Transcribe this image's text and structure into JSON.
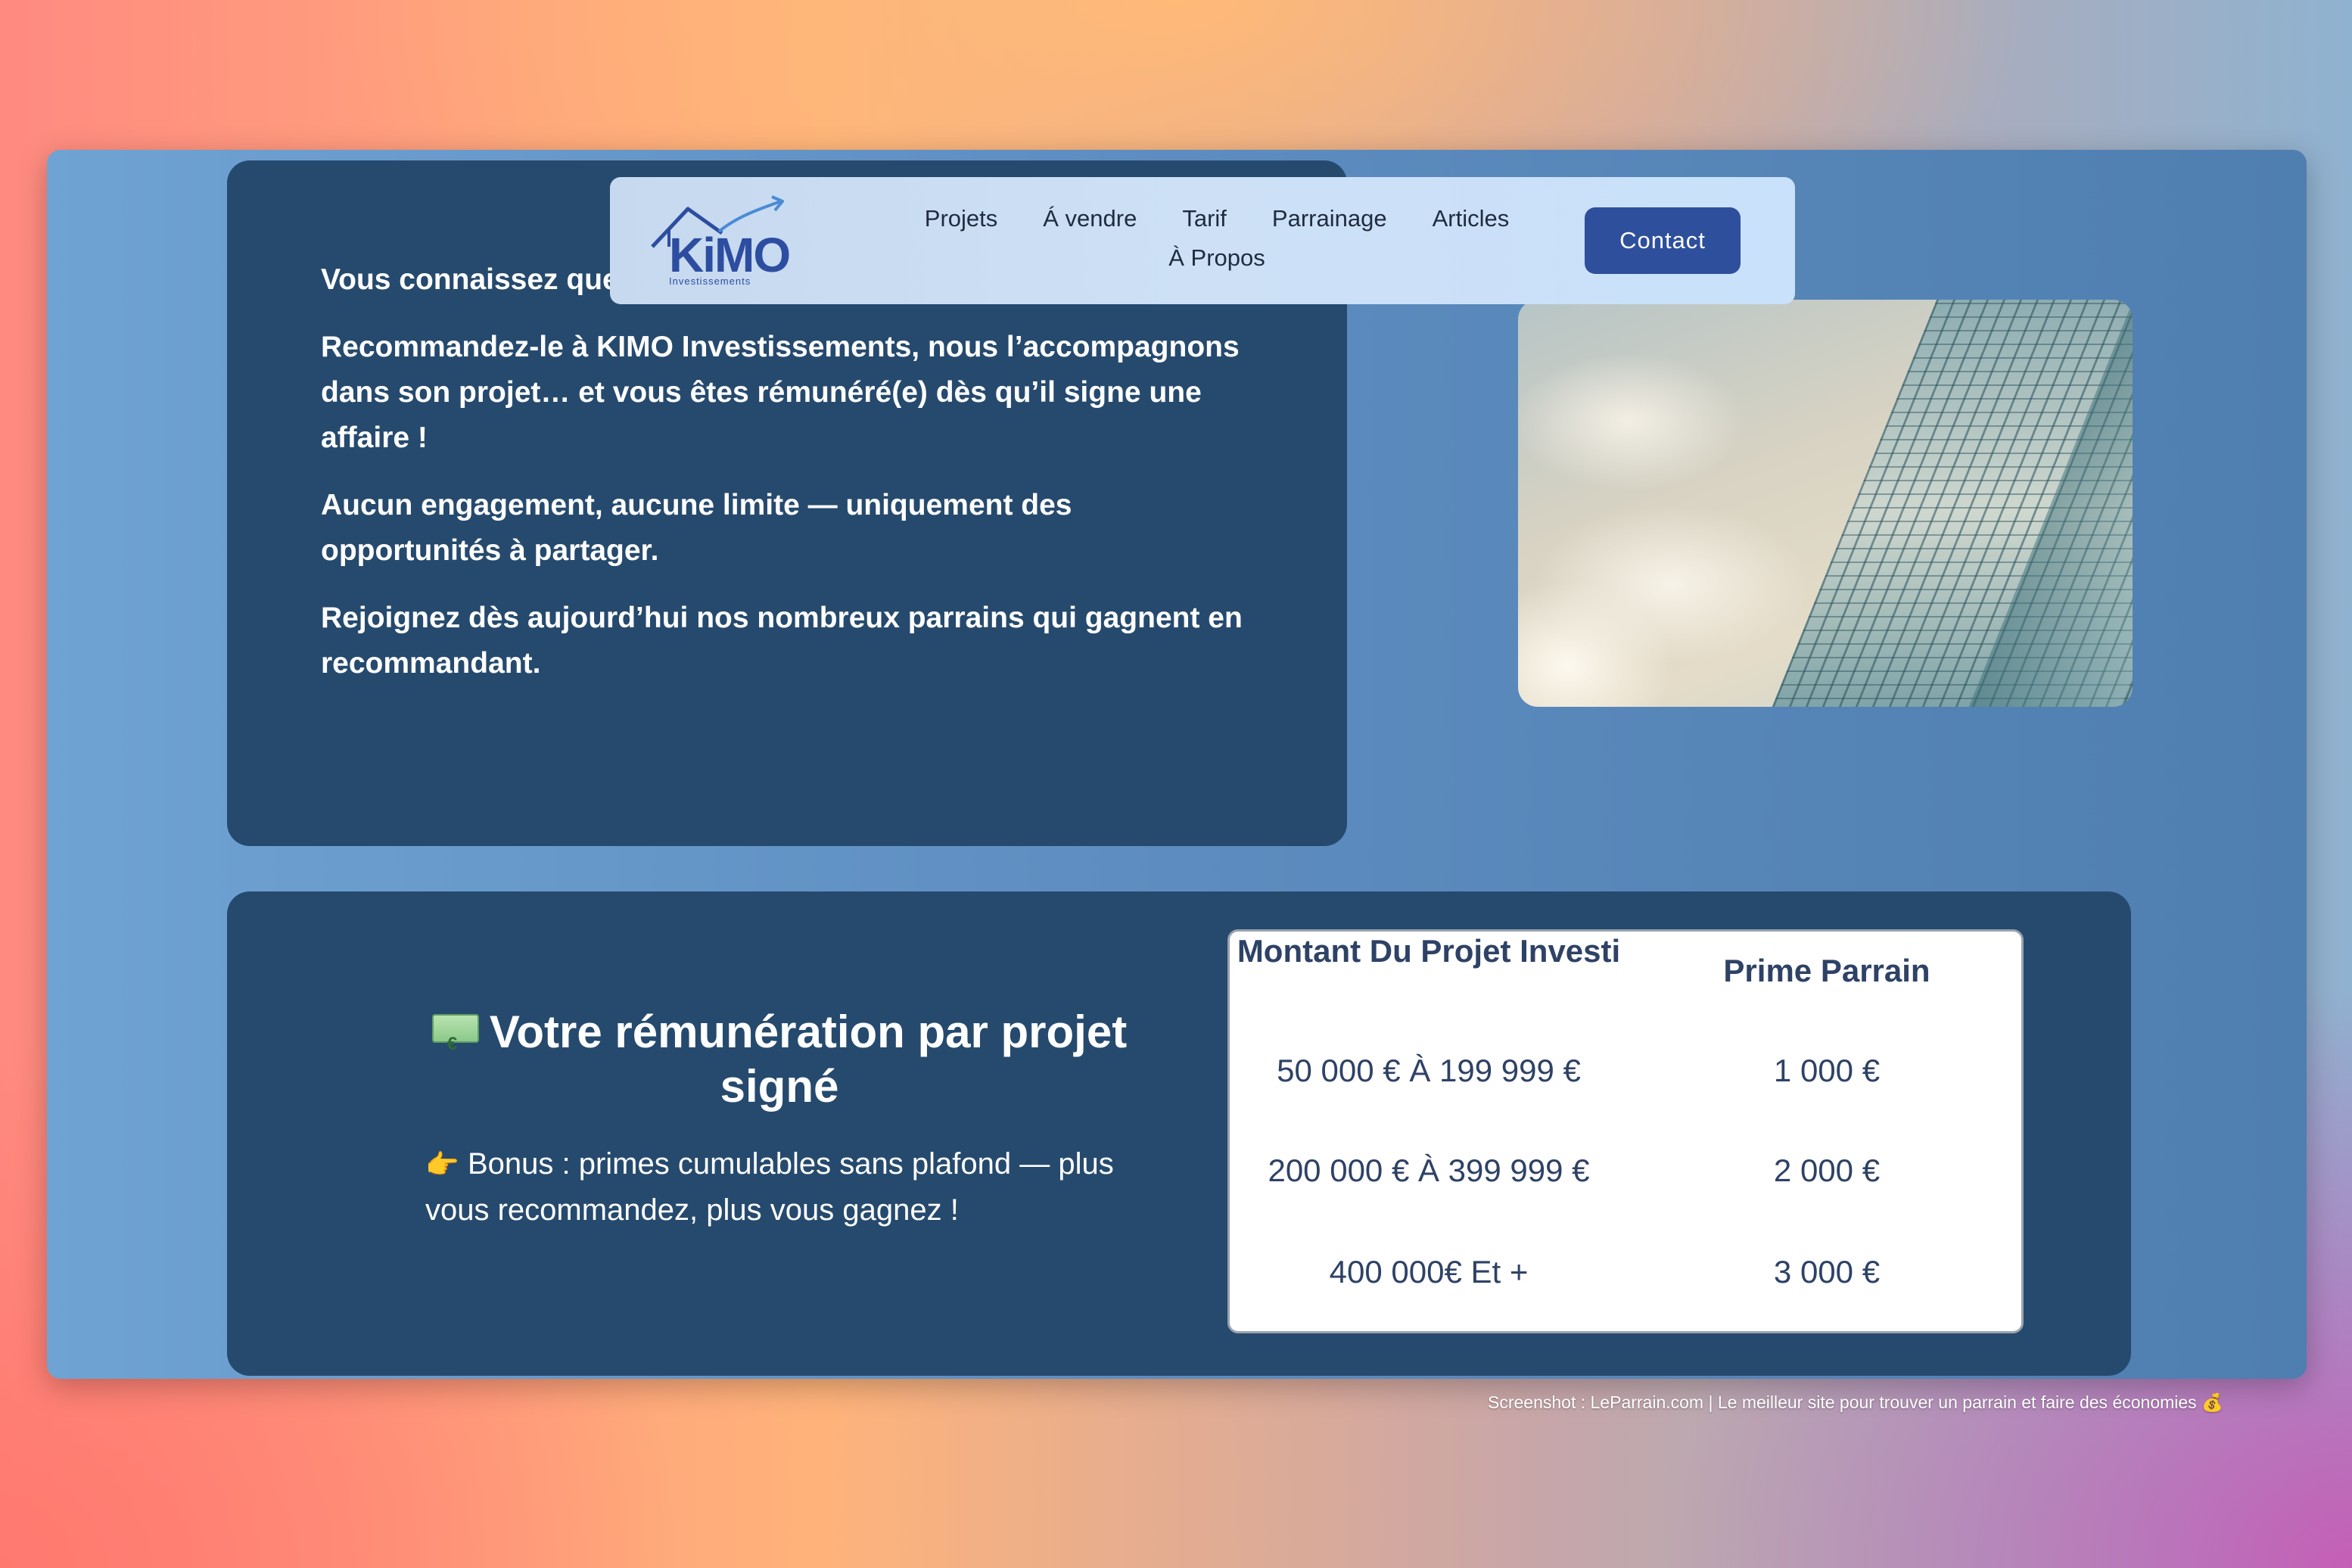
{
  "nav": {
    "logo_text": "KiMO",
    "logo_subtitle": "Investissements",
    "links": [
      "Projets",
      "Á vendre",
      "Tarif",
      "Parrainage",
      "Articles",
      "À Propos"
    ],
    "contact_label": "Contact"
  },
  "intro": {
    "paragraphs": [
      "Vous connaissez quelqu’un qui a un projet dans l’immobilier ?",
      "Recommandez-le à KIMO Investissements, nous l’accompagnons dans son projet… et vous êtes rémunéré(e) dès qu’il signe une affaire !",
      "Aucun engagement, aucune limite — uniquement des opportunités à partager.",
      "Rejoignez dès aujourd’hui nos nombreux parrains qui gagnent en recommandant."
    ]
  },
  "reward": {
    "title": "Votre rémunération par projet signé",
    "hand_emoji": "👉",
    "bonus": "Bonus : primes cumulables sans plafond — plus vous recommandez, plus vous gagnez !"
  },
  "table": {
    "headers": [
      "Montant Du Projet Investi",
      "Prime Parrain"
    ],
    "rows": [
      [
        "50 000 € À 199 999 €",
        "1 000 €"
      ],
      [
        "200 000 € À 399 999 €",
        "2 000 €"
      ],
      [
        "400 000€ Et +",
        "3 000 €"
      ]
    ]
  },
  "footer": {
    "note": "Screenshot : LeParrain.com | Le meilleur site pour trouver un parrain et faire des économies 💰"
  },
  "colors": {
    "card": "#264a6e",
    "button": "#2e4f9c",
    "window": "#5d8cc0"
  }
}
